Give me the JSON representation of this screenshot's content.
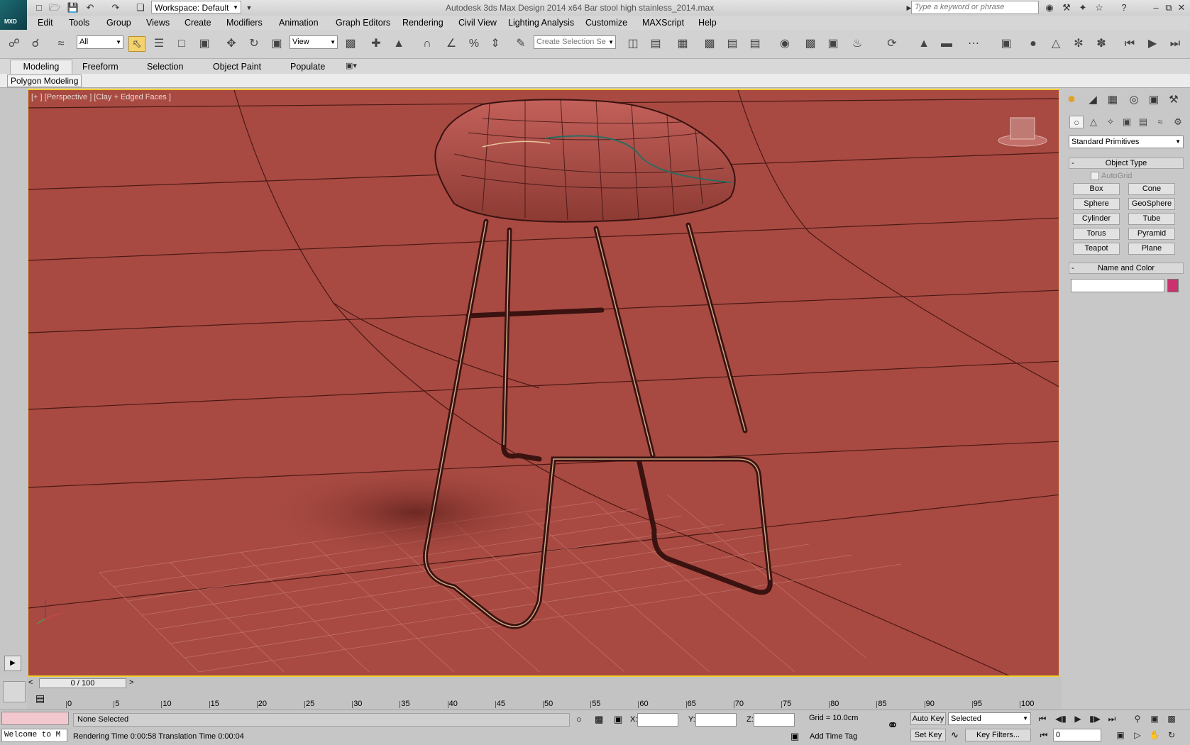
{
  "window": {
    "title": "Autodesk 3ds Max Design 2014 x64      Bar stool high stainless_2014.max",
    "logo_text": "MXD",
    "workspace": "Workspace: Default",
    "search_placeholder": "Type a keyword or phrase"
  },
  "menu": [
    "Edit",
    "Tools",
    "Group",
    "Views",
    "Create",
    "Modifiers",
    "Animation",
    "Graph Editors",
    "Rendering",
    "Civil View",
    "Lighting Analysis",
    "Customize",
    "MAXScript",
    "Help"
  ],
  "toolbar": {
    "filter": "All",
    "ref_coord": "View",
    "selection_set_placeholder": "Create Selection Se"
  },
  "ribbon": {
    "tabs": [
      "Modeling",
      "Freeform",
      "Selection",
      "Object Paint",
      "Populate"
    ],
    "active_tab": "Modeling",
    "panel_label": "Polygon Modeling"
  },
  "viewport": {
    "label": "[+ ] [Perspective ] [Clay + Edged Faces ]",
    "bg_color": "#a84a42",
    "border_color": "#f2cf2c"
  },
  "command_panel": {
    "category": "Standard Primitives",
    "object_type_title": "Object Type",
    "autogrid": "AutoGrid",
    "primitives": [
      "Box",
      "Cone",
      "Sphere",
      "GeoSphere",
      "Cylinder",
      "Tube",
      "Torus",
      "Pyramid",
      "Teapot",
      "Plane"
    ],
    "name_color_title": "Name and Color",
    "object_color": "#c8326e",
    "collapse_marker": "-"
  },
  "timeline": {
    "frame": "0 / 100",
    "ticks": [
      "0",
      "5",
      "10",
      "15",
      "20",
      "25",
      "30",
      "35",
      "40",
      "45",
      "50",
      "55",
      "60",
      "65",
      "70",
      "75",
      "80",
      "85",
      "90",
      "95",
      "100"
    ]
  },
  "status": {
    "listener": "Welcome to M",
    "selection": "None Selected",
    "prompt": "Rendering Time  0:00:58     Translation Time  0:00:04",
    "x_label": "X:",
    "y_label": "Y:",
    "z_label": "Z:",
    "grid": "Grid = 10.0cm",
    "add_time_tag": "Add Time Tag",
    "auto_key": "Auto Key",
    "set_key": "Set Key",
    "key_mode": "Selected",
    "key_filters": "Key Filters...",
    "current_frame": "0"
  }
}
